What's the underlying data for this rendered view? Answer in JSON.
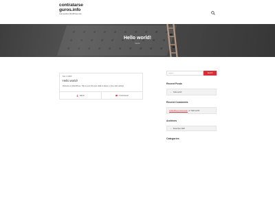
{
  "site": {
    "title_line1": "contratarse",
    "title_line2": "guros.info",
    "tagline": "Just another WordPress site"
  },
  "hero": {
    "title": "Hello world!",
    "breadcrumb": "Home"
  },
  "post": {
    "date": "Dec 2 2020",
    "title": "Hello world!",
    "excerpt": "Welcome to WordPress. This is your first post. Edit or delete it, then start writing!",
    "author": "Admin",
    "comments": "1 Comments"
  },
  "sidebar": {
    "search_placeholder": "Search …",
    "search_button": "Search",
    "recent_posts_title": "Recent Posts",
    "recent_posts": [
      "Hello world!"
    ],
    "recent_comments_title": "Recent Comments",
    "comment_author": "A WordPress Commenter",
    "comment_on": "on",
    "comment_post": "Hello world!",
    "archives_title": "Archives",
    "archives": [
      "December 2020"
    ],
    "categories_title": "Categories"
  },
  "colors": {
    "accent": "#d62f37",
    "hero_overlay": "#555555"
  },
  "icons": {
    "search": "search-icon",
    "author": "user-icon",
    "comments": "comment-icon",
    "list": "chevron-right-icon"
  }
}
